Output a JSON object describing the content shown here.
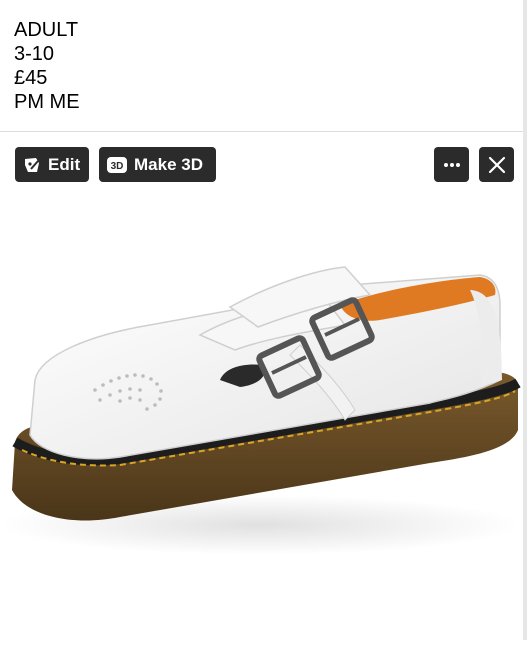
{
  "caption": {
    "lines": [
      "ADULT",
      "3-10",
      "£45",
      "PM ME"
    ]
  },
  "toolbar": {
    "edit_label": "Edit",
    "make3d_label": "Make 3D",
    "make3d_icon_text": "3D",
    "more_icon": "ellipsis-icon",
    "close_icon": "close-icon"
  },
  "photo": {
    "subject": "white-mary-jane-shoe"
  }
}
